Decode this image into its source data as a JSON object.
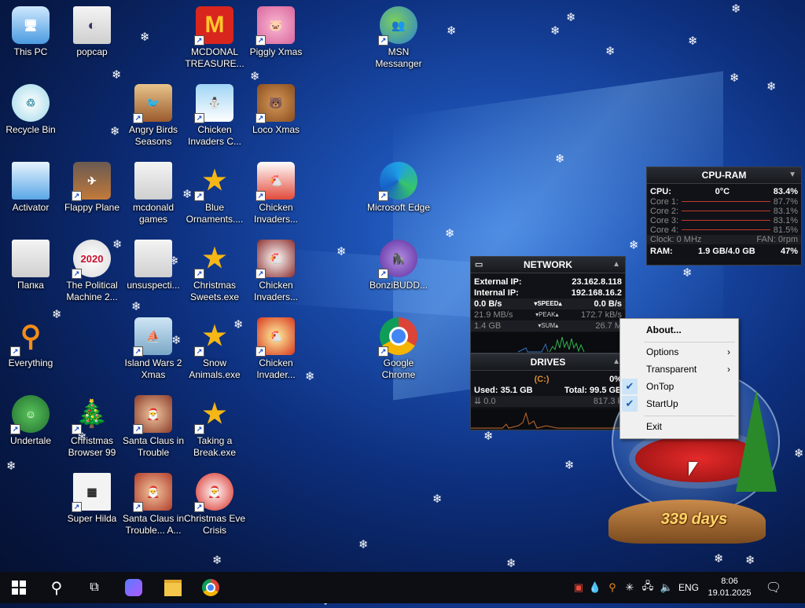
{
  "desktop": {
    "icons": [
      {
        "label": "This PC"
      },
      {
        "label": "popcap"
      },
      {
        "label": "MCDONAL TREASURE..."
      },
      {
        "label": "Piggly Xmas"
      },
      {
        "label": "MSN Messanger"
      },
      {
        "label": "Recycle Bin"
      },
      {
        "label": "Angry Birds Seasons"
      },
      {
        "label": "Chicken Invaders C..."
      },
      {
        "label": "Loco Xmas"
      },
      {
        "label": "Activator"
      },
      {
        "label": "Flappy Plane"
      },
      {
        "label": "mcdonald games"
      },
      {
        "label": "Blue Ornaments...."
      },
      {
        "label": "Chicken Invaders..."
      },
      {
        "label": "Microsoft Edge"
      },
      {
        "label": "Папка"
      },
      {
        "label": "The Political Machine 2..."
      },
      {
        "label": "unsuspecti..."
      },
      {
        "label": "Christmas Sweets.exe"
      },
      {
        "label": "Chicken Invaders..."
      },
      {
        "label": "BonziBUDD..."
      },
      {
        "label": "Everything"
      },
      {
        "label": "Island Wars 2 Xmas"
      },
      {
        "label": "Snow Animals.exe"
      },
      {
        "label": "Chicken Invader..."
      },
      {
        "label": "Google Chrome"
      },
      {
        "label": "Undertale"
      },
      {
        "label": "Christmas Browser 99"
      },
      {
        "label": "Santa Claus in Trouble"
      },
      {
        "label": "Taking a Break.exe"
      },
      {
        "label": "Super Hilda"
      },
      {
        "label": "Santa Claus in Trouble... A..."
      },
      {
        "label": "Christmas Eve Crisis"
      }
    ]
  },
  "cpu_ram": {
    "title": "CPU-RAM",
    "cpu_label": "CPU:",
    "cpu_temp": "0°C",
    "cpu_value": "83.4%",
    "cores": [
      {
        "label": "Core 1:",
        "value": "87.7%"
      },
      {
        "label": "Core 2:",
        "value": "83.1%"
      },
      {
        "label": "Core 3:",
        "value": "83.1%"
      },
      {
        "label": "Core 4:",
        "value": "81.5%"
      }
    ],
    "clock": "Clock: 0 MHz",
    "fan": "FAN: 0rpm",
    "ram_label": "RAM:",
    "ram_used": "1.9 GB/4.0 GB",
    "ram_value": "47%"
  },
  "network": {
    "title": "NETWORK",
    "external_label": "External IP:",
    "external_ip": "23.162.8.118",
    "internal_label": "Internal IP:",
    "internal_ip": "192.168.16.2",
    "speed_left": "0.0 B/s",
    "speed_label": "SPEED",
    "speed_right": "0.0 B/s",
    "peak_left": "21.9 MB/s",
    "peak_label": "PEAK",
    "peak_right": "172.7 kB/s",
    "sum_left": "1.4 GB",
    "sum_label": "SUM",
    "sum_right": "26.7 M"
  },
  "drives": {
    "title": "DRIVES",
    "drive": "(C:)",
    "percent": "0%",
    "used": "Used: 35.1 GB",
    "total": "Total: 99.5 GB",
    "read": "0.0",
    "write": "817.3 k"
  },
  "context_menu": {
    "items": [
      {
        "label": "About...",
        "checked": false,
        "submenu": false
      },
      {
        "label": "Options",
        "checked": false,
        "submenu": true
      },
      {
        "label": "Transparent",
        "checked": false,
        "submenu": true
      },
      {
        "label": "OnTop",
        "checked": true,
        "submenu": false
      },
      {
        "label": "StartUp",
        "checked": true,
        "submenu": false
      },
      {
        "label": "Exit",
        "checked": false,
        "submenu": false
      }
    ]
  },
  "snowglobe": {
    "days": "339 days"
  },
  "taskbar": {
    "language": "ENG",
    "time": "8:06",
    "date": "19.01.2025"
  },
  "colors": {
    "accent": "#1f5fb0",
    "taskbar": "#0c0e14",
    "menu_highlight": "#cce4f7"
  }
}
